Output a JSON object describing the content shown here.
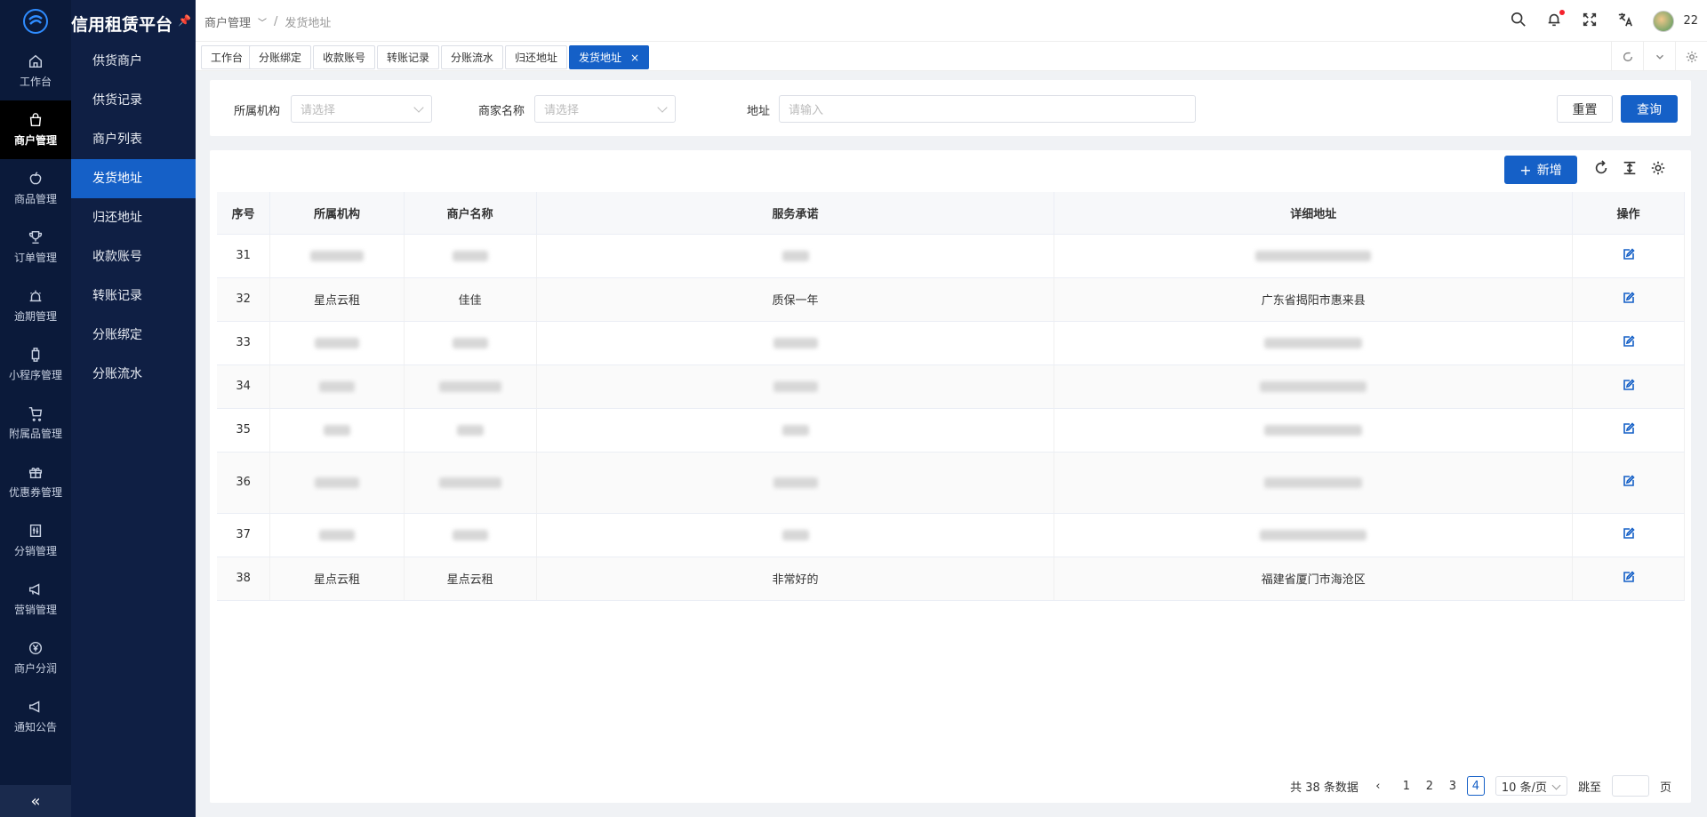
{
  "app": {
    "title": "信用租赁平台"
  },
  "rail": [
    {
      "label": "工作台",
      "icon": "home-icon"
    },
    {
      "label": "商户管理",
      "icon": "shop-icon",
      "active": true
    },
    {
      "label": "商品管理",
      "icon": "apple-icon"
    },
    {
      "label": "订单管理",
      "icon": "trophy-icon"
    },
    {
      "label": "逾期管理",
      "icon": "siren-icon"
    },
    {
      "label": "小程序管理",
      "icon": "watch-icon"
    },
    {
      "label": "附属品管理",
      "icon": "cart-icon"
    },
    {
      "label": "优惠券管理",
      "icon": "gift-icon"
    },
    {
      "label": "分销管理",
      "icon": "sliders-icon"
    },
    {
      "label": "营销管理",
      "icon": "megaphone-icon"
    },
    {
      "label": "商户分润",
      "icon": "yen-icon"
    },
    {
      "label": "通知公告",
      "icon": "notice-icon"
    }
  ],
  "submenu": [
    {
      "label": "供货商户"
    },
    {
      "label": "供货记录"
    },
    {
      "label": "商户列表"
    },
    {
      "label": "发货地址",
      "active": true
    },
    {
      "label": "归还地址"
    },
    {
      "label": "收款账号"
    },
    {
      "label": "转账记录"
    },
    {
      "label": "分账绑定"
    },
    {
      "label": "分账流水"
    }
  ],
  "breadcrumb": {
    "parent": "商户管理",
    "current": "发货地址"
  },
  "user": {
    "name": "22"
  },
  "tabs": [
    {
      "label": "工作台"
    },
    {
      "label": "分账绑定"
    },
    {
      "label": "收款账号"
    },
    {
      "label": "转账记录"
    },
    {
      "label": "分账流水"
    },
    {
      "label": "归还地址"
    },
    {
      "label": "发货地址",
      "active": true
    }
  ],
  "filter": {
    "org_label": "所属机构",
    "org_placeholder": "请选择",
    "merchant_label": "商家名称",
    "merchant_placeholder": "请选择",
    "address_label": "地址",
    "address_placeholder": "请输入",
    "reset_label": "重置",
    "search_label": "查询"
  },
  "toolbar": {
    "add_label": "新增"
  },
  "table": {
    "columns": [
      "序号",
      "所属机构",
      "商户名称",
      "服务承诺",
      "详细地址",
      "操作"
    ],
    "rows": [
      {
        "no": "31",
        "org": "",
        "merchant": "",
        "promise": "",
        "address": ""
      },
      {
        "no": "32",
        "org": "星点云租",
        "merchant": "佳佳",
        "promise": "质保一年",
        "address": "广东省揭阳市惠来县"
      },
      {
        "no": "33",
        "org": "",
        "merchant": "",
        "promise": "",
        "address": ""
      },
      {
        "no": "34",
        "org": "",
        "merchant": "",
        "promise": "",
        "address": ""
      },
      {
        "no": "35",
        "org": "",
        "merchant": "",
        "promise": "",
        "address": ""
      },
      {
        "no": "36",
        "org": "",
        "merchant": "",
        "promise": "",
        "address": ""
      },
      {
        "no": "37",
        "org": "",
        "merchant": "",
        "promise": "",
        "address": ""
      },
      {
        "no": "38",
        "org": "星点云租",
        "merchant": "星点云租",
        "promise": "非常好的",
        "address": "福建省厦门市海沧区"
      }
    ]
  },
  "pagination": {
    "total_text": "共 38 条数据",
    "pages": [
      "1",
      "2",
      "3",
      "4"
    ],
    "current": "4",
    "page_size": "10 条/页",
    "jump_label": "跳至",
    "page_unit": "页"
  }
}
